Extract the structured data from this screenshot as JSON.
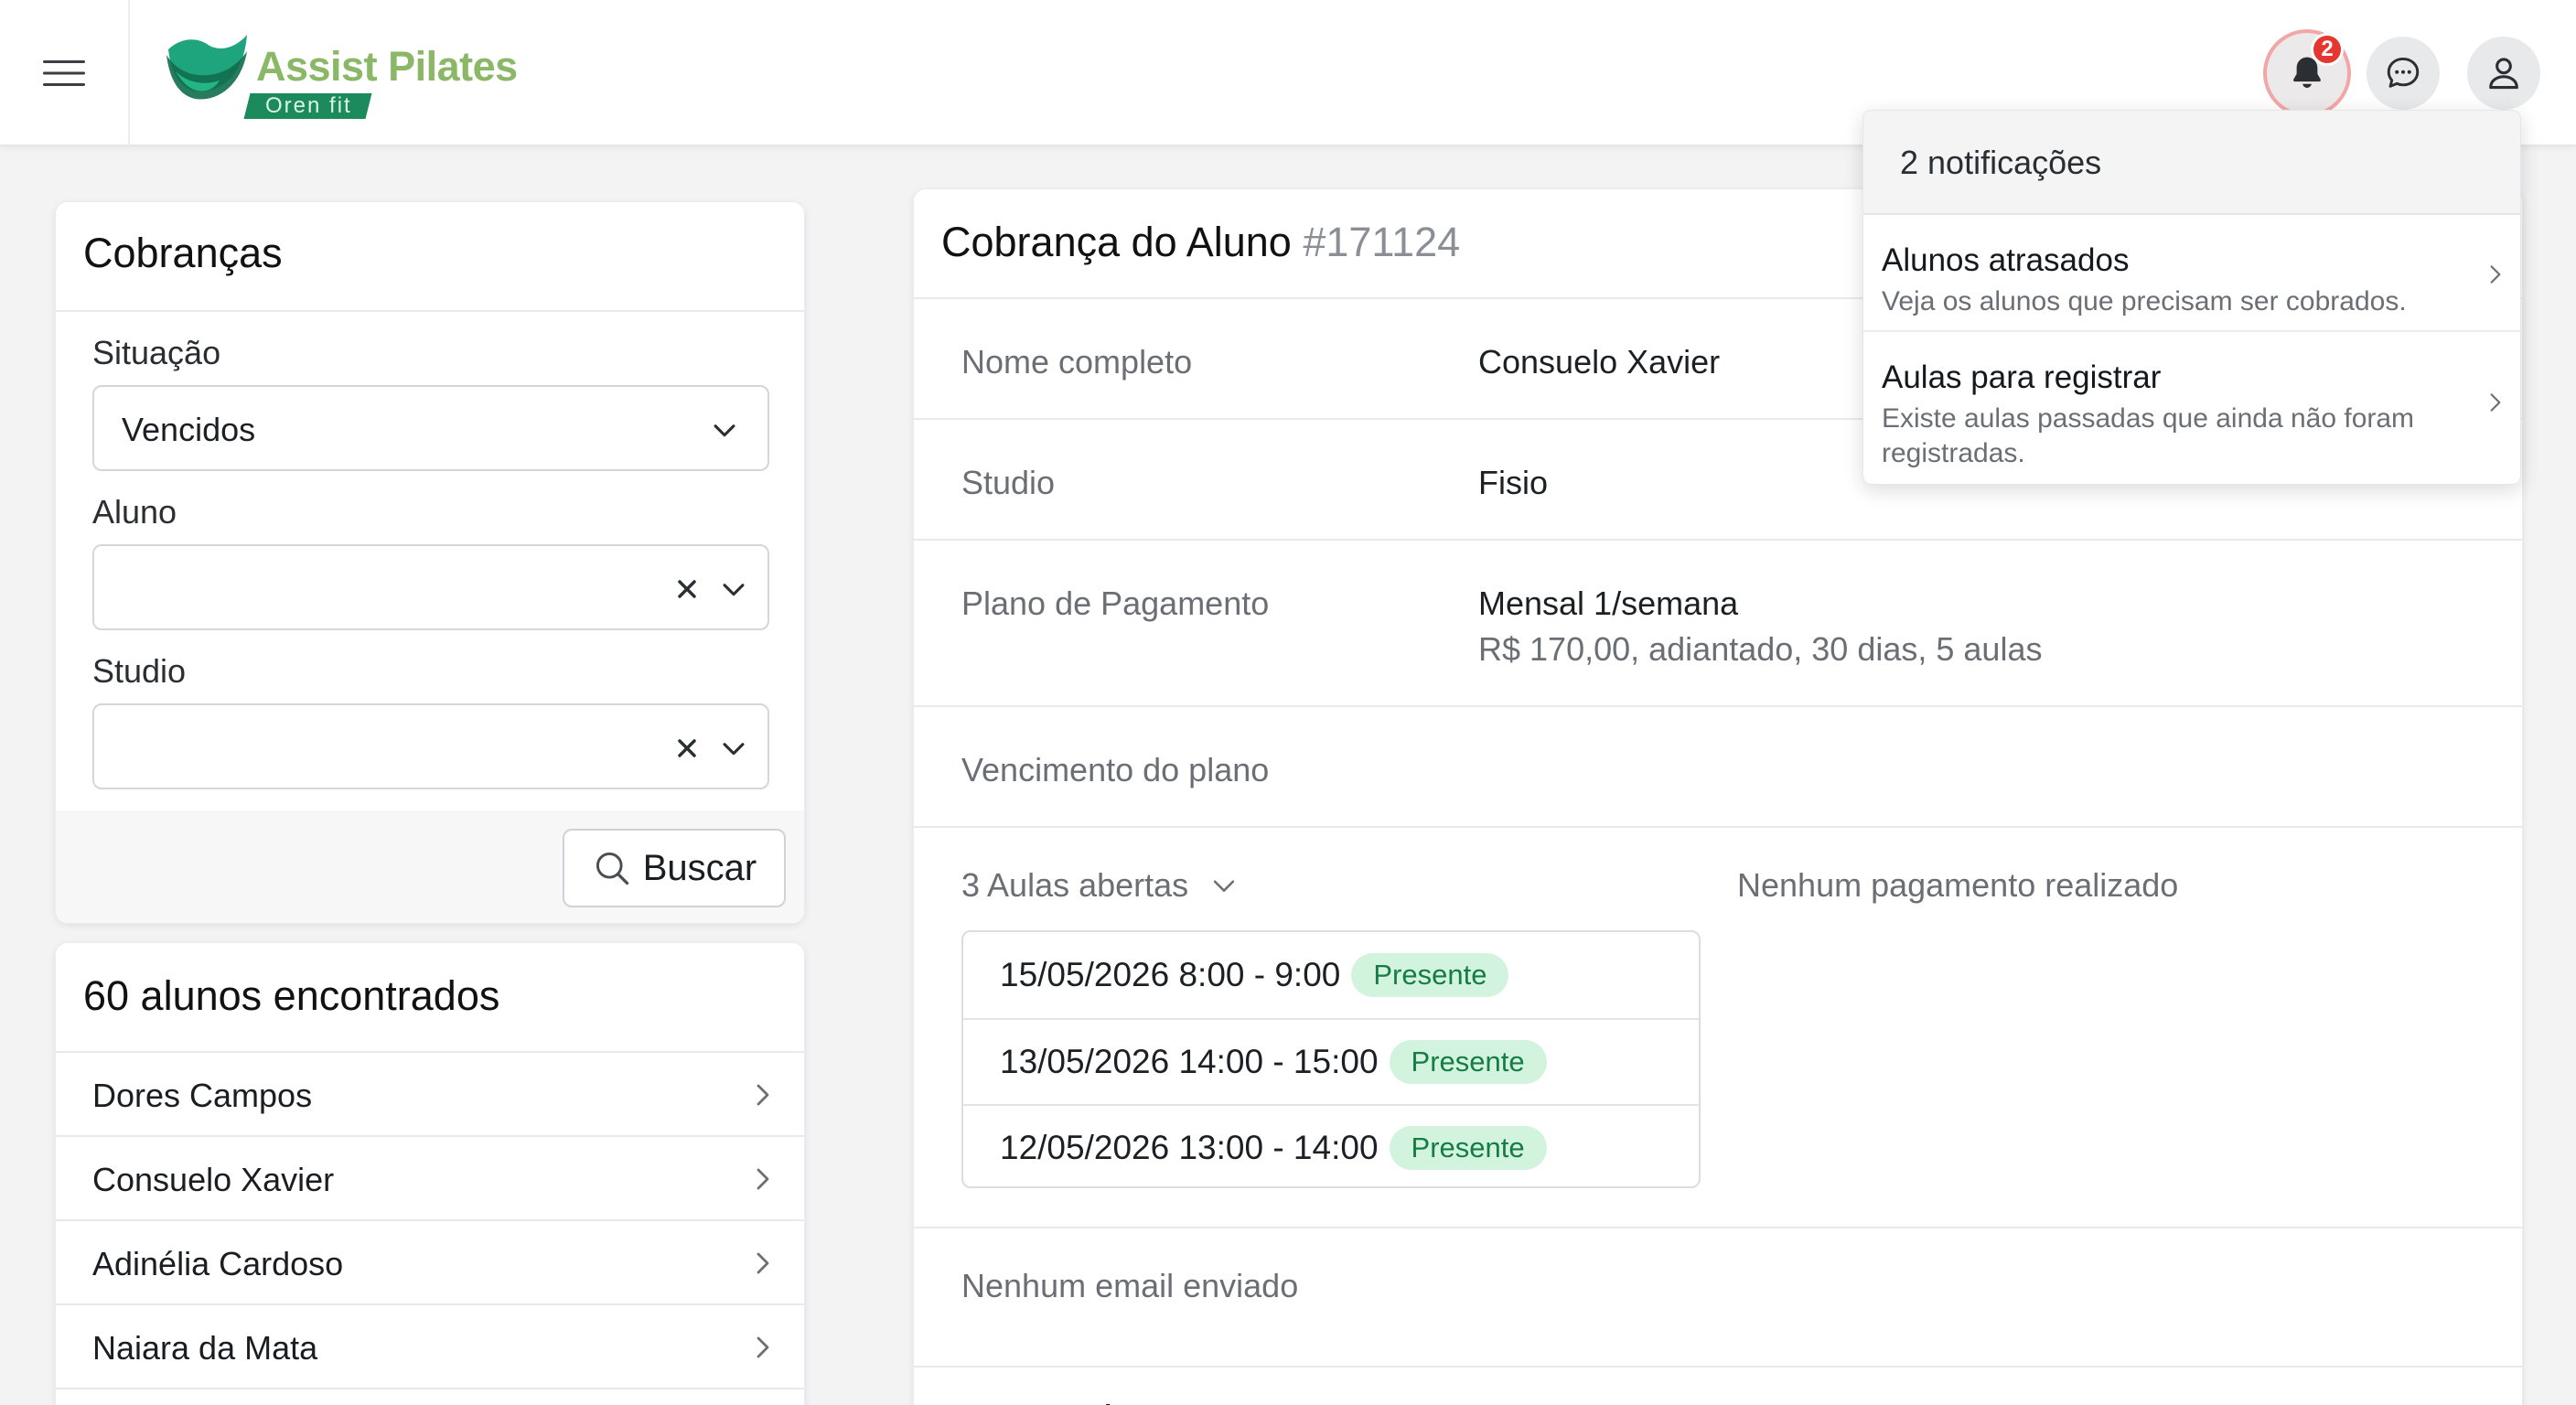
{
  "header": {
    "brand_name": "Assist Pilates",
    "brand_sub": "Oren fit",
    "notification_count": "2",
    "icons": [
      "hamburger-icon",
      "bell-icon",
      "chat-icon",
      "user-icon"
    ]
  },
  "filters": {
    "title": "Cobranças",
    "situacao_label": "Situação",
    "situacao_value": "Vencidos",
    "aluno_label": "Aluno",
    "aluno_value": "",
    "studio_label": "Studio",
    "studio_value": "",
    "search_button": "Buscar"
  },
  "students": {
    "title": "60 alunos encontrados",
    "items": [
      {
        "name": "Dores Campos"
      },
      {
        "name": "Consuelo Xavier"
      },
      {
        "name": "Adinélia Cardoso"
      },
      {
        "name": "Naiara da Mata"
      }
    ]
  },
  "charge": {
    "title": "Cobrança do Aluno",
    "number": "#171124",
    "nome_label": "Nome completo",
    "nome_value": "Consuelo Xavier",
    "studio_label": "Studio",
    "studio_value": "Fisio",
    "plano_label": "Plano de Pagamento",
    "plano_value": "Mensal 1/semana",
    "plano_detail": "R$ 170,00, adiantado, 30 dias, 5 aulas",
    "vencimento_label": "Vencimento do plano",
    "aulas_toggle": "3 Aulas abertas",
    "no_payment": "Nenhum pagamento realizado",
    "aulas": [
      {
        "date": "15/05/2026 8:00 - 9:00",
        "status": "Presente"
      },
      {
        "date": "13/05/2026 14:00 - 15:00",
        "status": "Presente"
      },
      {
        "date": "12/05/2026 13:00 - 14:00",
        "status": "Presente"
      }
    ],
    "no_email": "Nenhum email enviado",
    "cut_section": "Funçoed"
  },
  "notifications": {
    "header": "2 notificações",
    "items": [
      {
        "title": "Alunos atrasados",
        "desc": "Veja os alunos que precisam ser cobrados."
      },
      {
        "title": "Aulas para registrar",
        "desc": "Existe aulas passadas que ainda não foram registradas."
      }
    ]
  },
  "colors": {
    "brand_green": "#8ab867",
    "brand_dark": "#1c8a5a",
    "badge_red": "#e5372f",
    "present_bg": "#d2f4df",
    "present_text": "#167c45"
  }
}
